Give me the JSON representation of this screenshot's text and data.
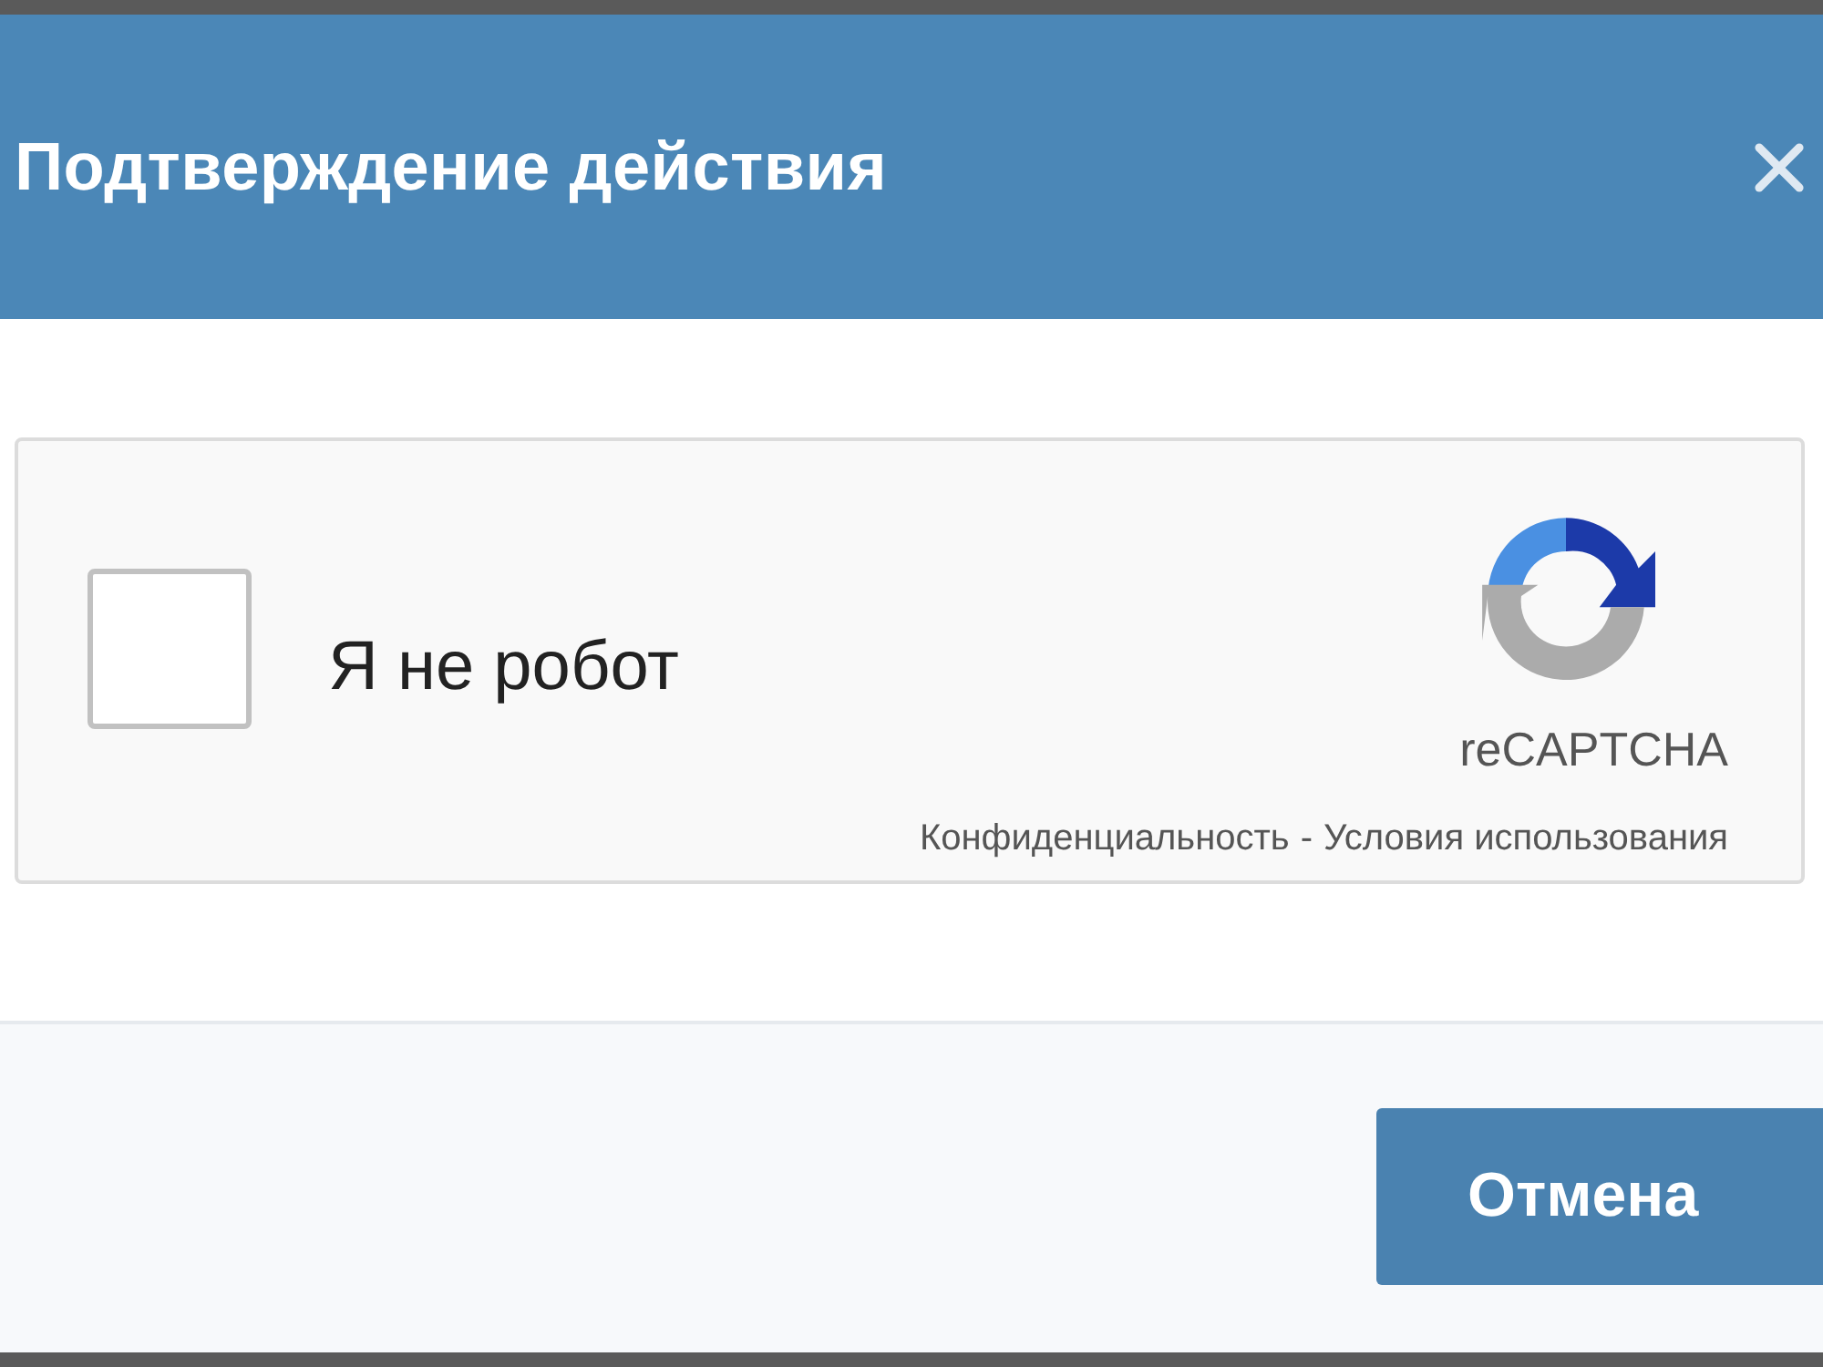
{
  "dialog": {
    "title": "Подтверждение действия"
  },
  "captcha": {
    "checked": false,
    "label": "Я не робот",
    "brand": "reCAPTCHA",
    "links": [
      "Конфиденциальность",
      "Условия использования"
    ],
    "separator": "-"
  },
  "buttons": [
    {
      "label": "Отмена"
    }
  ]
}
